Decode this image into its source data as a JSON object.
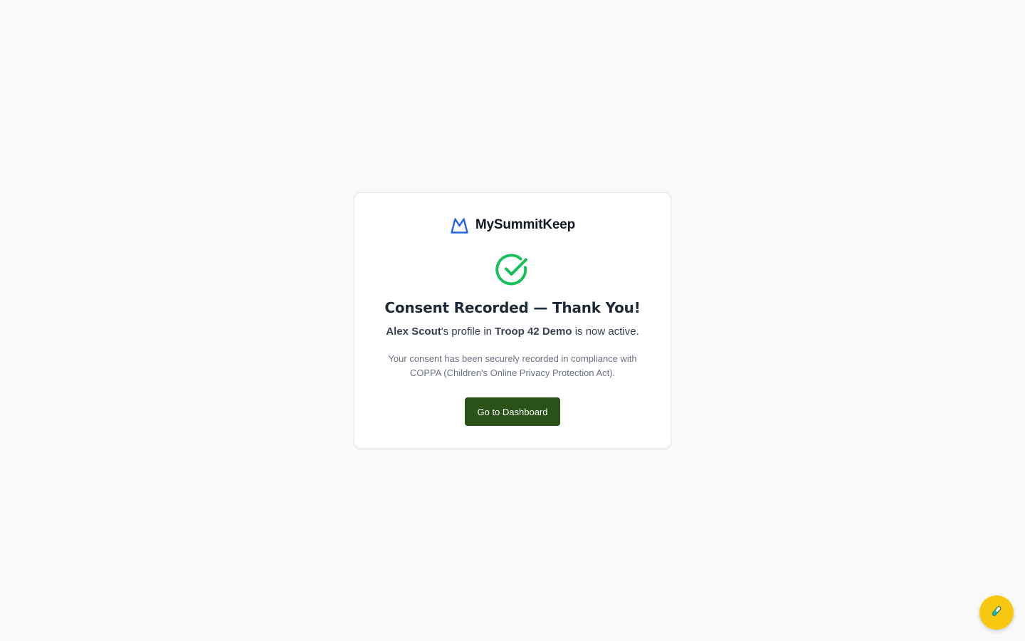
{
  "brand": {
    "name": "MySummitKeep",
    "icon": "mountain-icon",
    "color": "#2563eb"
  },
  "status": {
    "icon": "check-circle-icon",
    "color": "#16c05a"
  },
  "confirmation": {
    "title": "Consent Recorded — Thank You!",
    "scout_name": "Alex Scout",
    "possessive_suffix": "'s profile in ",
    "troop_name": "Troop 42 Demo",
    "status_suffix": " is now active.",
    "note": "Your consent has been securely recorded in compliance with COPPA (Children's Online Privacy Protection Act)."
  },
  "actions": {
    "dashboard_label": "Go to Dashboard",
    "dashboard_color": "#2a5218"
  },
  "floating_button": {
    "icon": "test-tube-icon",
    "color": "#f8c810"
  }
}
